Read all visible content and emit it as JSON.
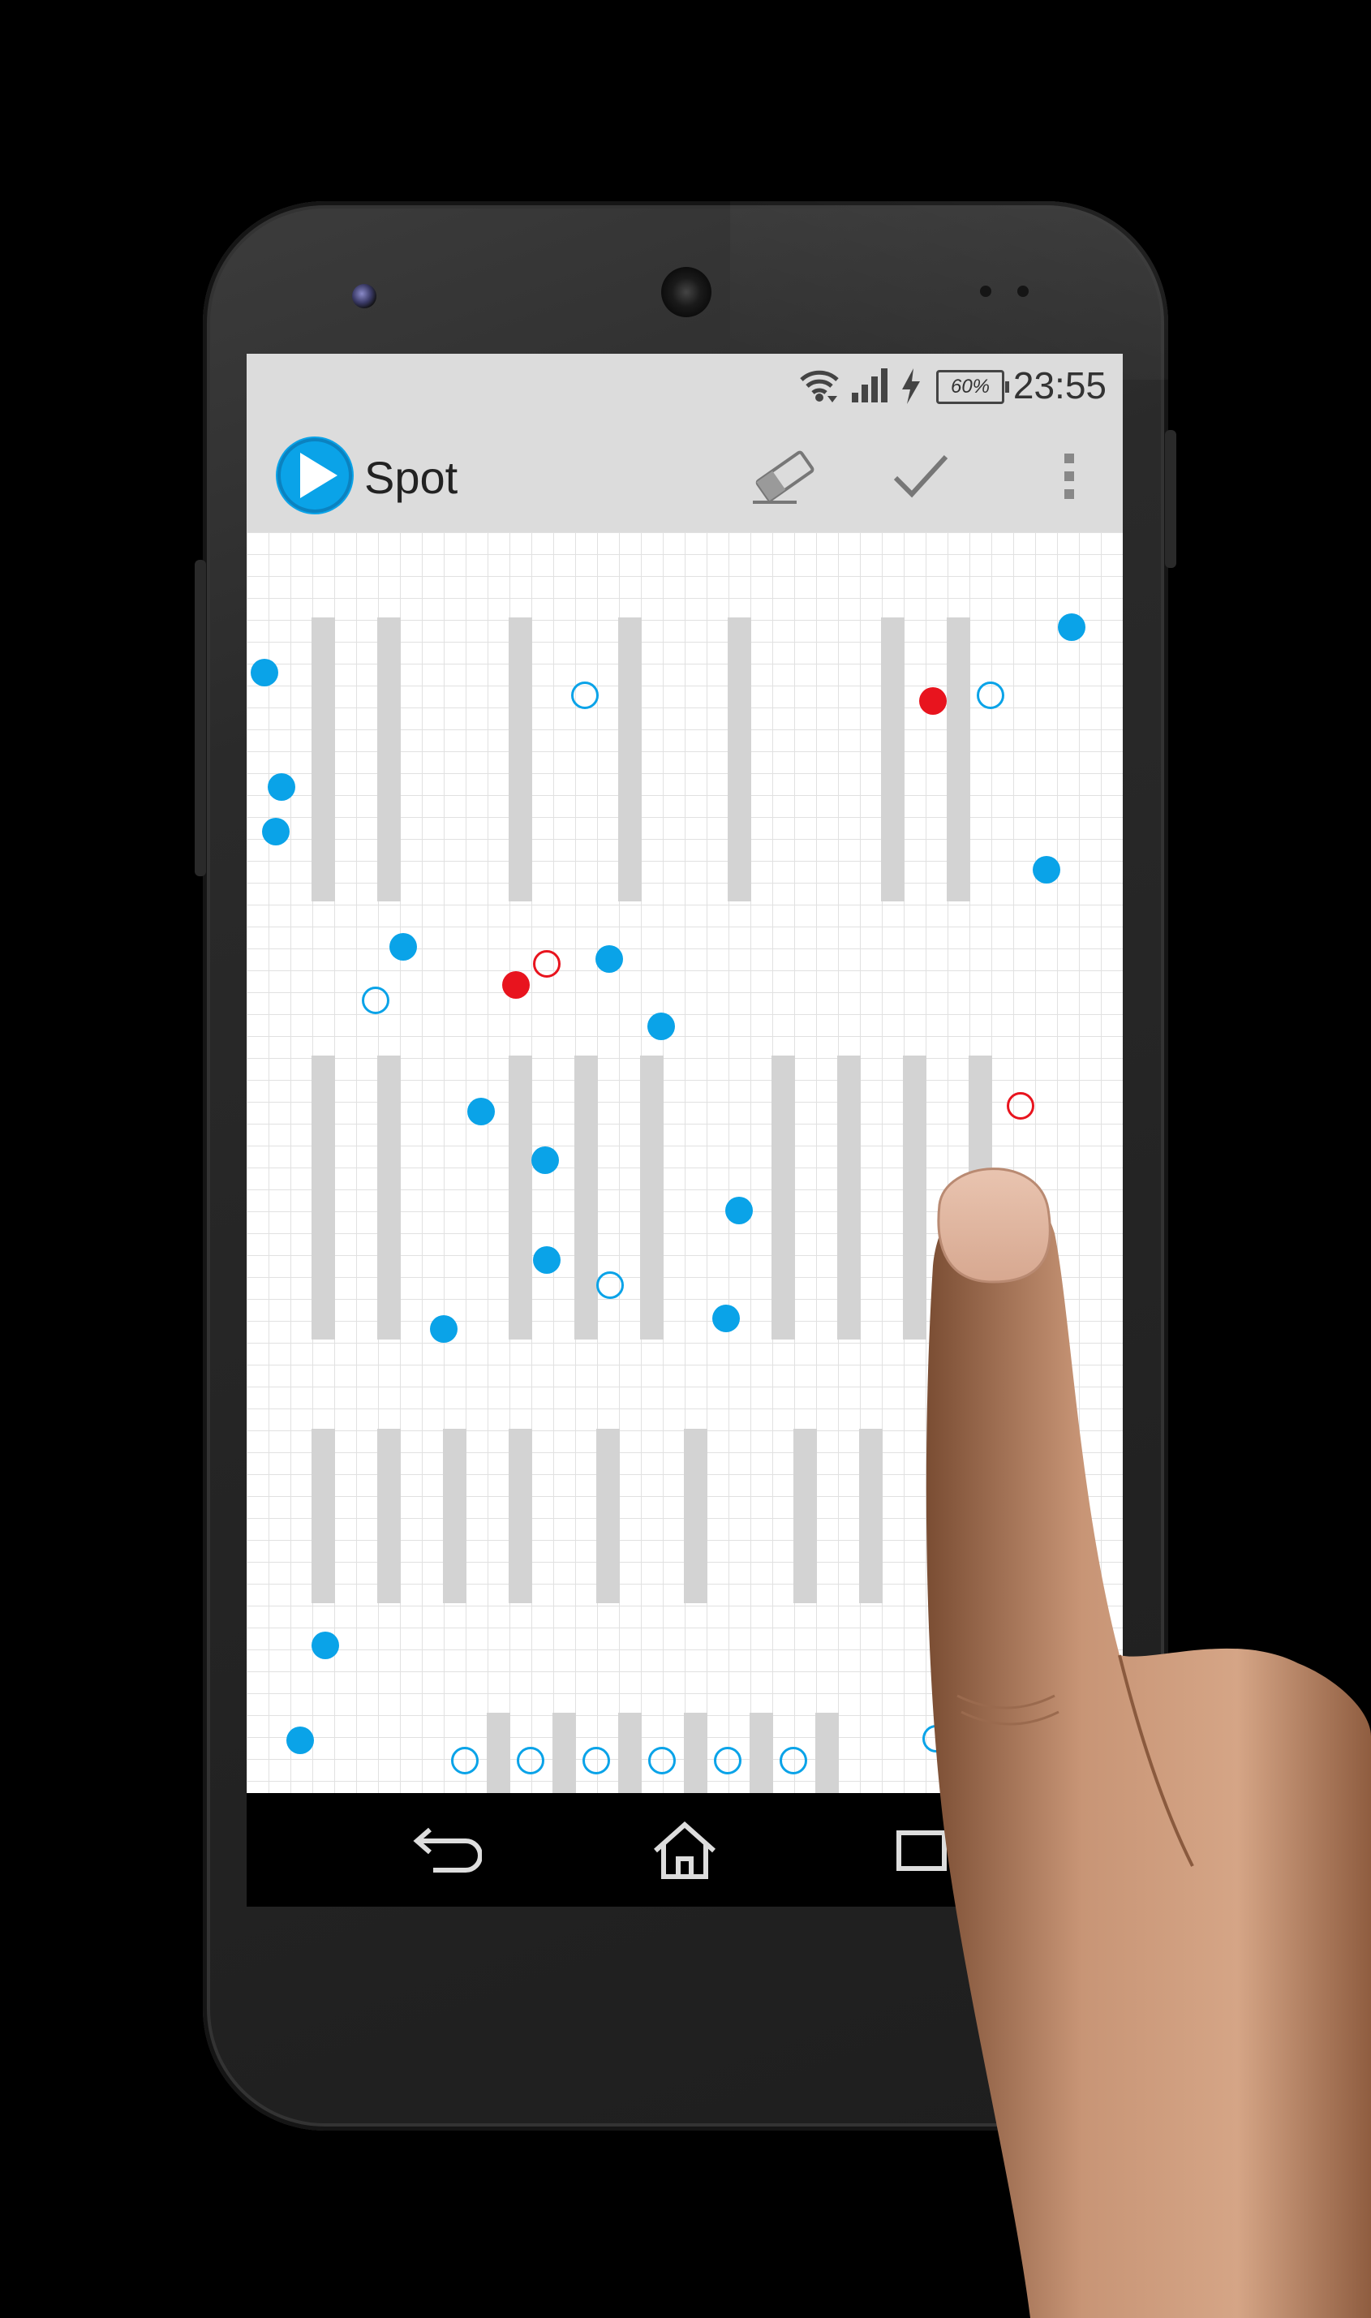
{
  "status_bar": {
    "battery_level": "60%",
    "time": "23:55",
    "icons": [
      "wifi-icon",
      "signal-icon",
      "charging-icon",
      "battery-icon"
    ]
  },
  "action_bar": {
    "title": "Spot",
    "logo_icon": "play-icon",
    "actions": [
      "eraser-icon",
      "check-icon",
      "overflow-menu-icon"
    ]
  },
  "nav_bar": {
    "buttons": [
      "back-icon",
      "home-icon",
      "recents-icon"
    ]
  },
  "colors": {
    "accent": "#0aa3e8",
    "marker_red": "#e8141e",
    "bar_gray": "#d3d3d3",
    "grid_line": "#e1e1e1",
    "status_bar_bg": "#dcdcdc"
  }
}
